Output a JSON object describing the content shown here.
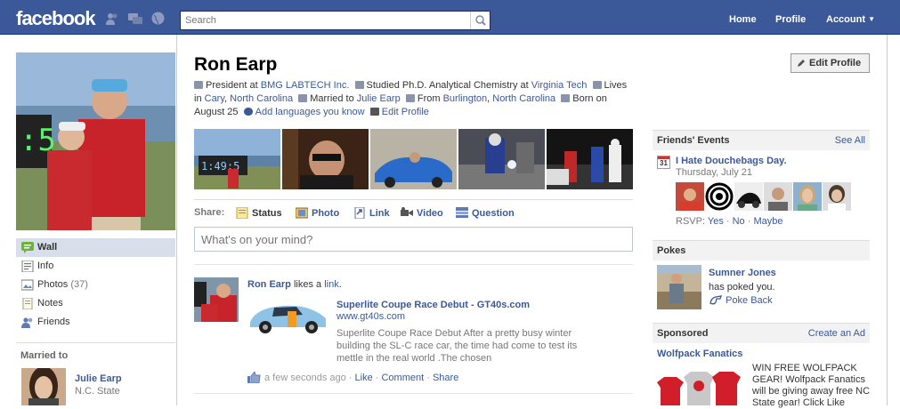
{
  "topbar": {
    "logo": "facebook",
    "search_placeholder": "Search",
    "nav": [
      "Home",
      "Profile",
      "Account"
    ]
  },
  "left": {
    "nav": [
      {
        "label": "Wall",
        "active": true
      },
      {
        "label": "Info"
      },
      {
        "label": "Photos"
      },
      {
        "label": "Notes"
      },
      {
        "label": "Friends"
      }
    ],
    "photos_count": "(37)",
    "married_header": "Married to",
    "spouse_name": "Julie Earp",
    "spouse_school": "N.C. State"
  },
  "profile": {
    "name": "Ron Earp",
    "edit_button": "Edit Profile",
    "info": {
      "work_prefix": "President at ",
      "work": "BMG LABTECH Inc.",
      "study_prefix": "Studied Ph.D. Analytical Chemistry at ",
      "school": "Virginia Tech",
      "lives_prefix": "Lives in ",
      "city": "Cary",
      "state": "North Carolina",
      "married_prefix": "Married to ",
      "spouse": "Julie Earp",
      "from_prefix": "From ",
      "hometown": "Burlington",
      "hometown_state": "North Carolina",
      "born": "Born on August 25",
      "add_languages": "Add languages you know",
      "edit_profile": "Edit Profile"
    }
  },
  "share": {
    "label": "Share:",
    "items": [
      "Status",
      "Photo",
      "Link",
      "Video",
      "Question"
    ],
    "placeholder": "What's on your mind?"
  },
  "story": {
    "actor": "Ron Earp",
    "verb": " likes a ",
    "object": "link",
    "title": "Superlite Coupe Race Debut - GT40s.com",
    "url": "www.gt40s.com",
    "desc": "Superlite Coupe Race Debut After a pretty busy winter building the SL-C race car, the time had come to test its mettle in the real world .The chosen",
    "time": "a few seconds ago",
    "actions": [
      "Like",
      "Comment",
      "Share"
    ]
  },
  "right": {
    "events_header": "Friends' Events",
    "see_all": "See All",
    "cal_day": "31",
    "event_title": "I Hate Douchebags Day.",
    "event_date": "Thursday, July 21",
    "rsvp_label": "RSVP: ",
    "rsvp": [
      "Yes",
      "No",
      "Maybe"
    ],
    "pokes_header": "Pokes",
    "poke_name": "Sumner Jones",
    "poke_text": "has poked you.",
    "poke_back": "Poke Back",
    "sponsored_header": "Sponsored",
    "create_ad": "Create an Ad",
    "ad_title": "Wolfpack Fanatics",
    "ad_text": "WIN FREE WOLFPACK GEAR! Wolfpack Fanatics will be giving away free NC State gear! Click Like"
  }
}
